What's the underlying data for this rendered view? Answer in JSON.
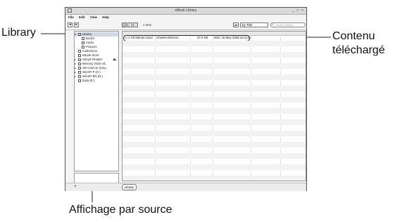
{
  "annotations": {
    "library": "Library",
    "contenu_line1": "Contenu",
    "contenu_line2": "téléchargé",
    "affichage": "Affichage par source"
  },
  "window": {
    "title": "eBook Library",
    "controls": "_ □ ×"
  },
  "menu": [
    "File",
    "Edit",
    "View",
    "Help"
  ],
  "toolbar": {
    "back": "◂",
    "forward": "▸",
    "items_count": "1 Item",
    "sort_arrows": "▴▾",
    "sort_by": "by Title",
    "search_placeholder": "Search library"
  },
  "sidebar": {
    "items": [
      {
        "label": "Library",
        "icon": "library-icon",
        "selected": true
      },
      {
        "label": "Books",
        "icon": "books-icon"
      },
      {
        "label": "Audio",
        "icon": "audio-icon"
      },
      {
        "label": "Pictures",
        "icon": "pictures-icon"
      },
      {
        "label": "Collections",
        "icon": "collections-icon"
      },
      {
        "label": "eBook Store",
        "icon": "store-icon"
      },
      {
        "label": "Sony® Reader",
        "icon": "reader-icon"
      },
      {
        "label": "Memory Stick ed...",
        "icon": "memory-stick-icon"
      },
      {
        "label": "SD Card on Sony...",
        "icon": "sd-card-icon"
      },
      {
        "label": "WinXP-P (C:)",
        "icon": "drive-icon"
      },
      {
        "label": "WinXP-EN (D:)",
        "icon": "drive-icon"
      },
      {
        "label": "Data (E:)",
        "icon": "drive-icon"
      }
    ]
  },
  "list": {
    "rows": [
      {
        "title": "A Christmas Carol",
        "author": "Charles Dickens",
        "size": "37.6 KB",
        "date": "Mon, 15 May 2006 10:11:17"
      }
    ]
  },
  "bottom": {
    "add": "+",
    "tab_label": "Library"
  }
}
